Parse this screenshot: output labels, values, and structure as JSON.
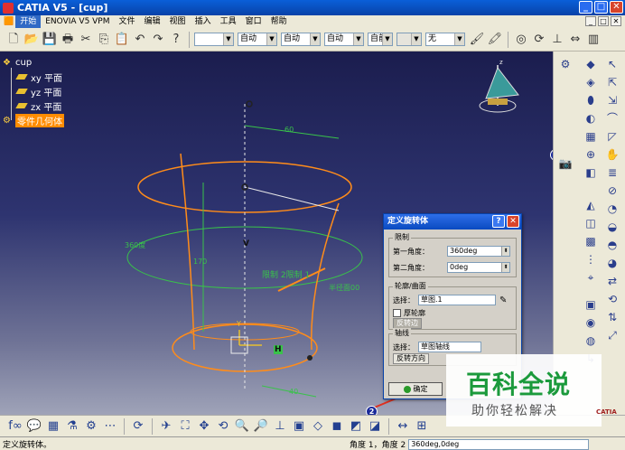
{
  "window": {
    "title": "CATIA V5 - [cup]",
    "buttons": [
      "_",
      "□",
      "✕"
    ]
  },
  "menu": {
    "items": [
      "开始",
      "ENOVIA V5 VPM",
      "文件",
      "编辑",
      "视图",
      "插入",
      "工具",
      "窗口",
      "帮助"
    ],
    "active_index": 0,
    "doc_buttons": [
      "_",
      "□",
      "✕"
    ]
  },
  "toolbar": {
    "selects": [
      {
        "value": ""
      },
      {
        "value": "自动"
      },
      {
        "value": "自动"
      },
      {
        "value": "自动"
      },
      {
        "value": "自前"
      },
      {
        "value": ""
      },
      {
        "value": "无"
      }
    ]
  },
  "tree": {
    "root": "cup",
    "items": [
      "xy 平面",
      "yz 平面",
      "zx 平面"
    ],
    "selected": "零件几何体"
  },
  "viewport": {
    "labels": {
      "dim_60": "60",
      "dim_360": "360度",
      "dim_h": "170",
      "limit_label": "限制 2限制 1",
      "profile_label": "半径面00",
      "v_label": "V",
      "h_label": "H",
      "y_label": "Y",
      "dim_bottom": "40"
    },
    "colors": {
      "profile": "#ff8c1a",
      "dimension": "#39c24a",
      "axis": "#e8e8e8"
    }
  },
  "dialog": {
    "title": "定义旋转体",
    "limits_group": "限制",
    "first_angle_label": "第一角度：",
    "first_angle_value": "360deg",
    "second_angle_label": "第二角度：",
    "second_angle_value": "0deg",
    "profile_group": "轮廓/曲面",
    "select_label": "选择：",
    "profile_value": "草图.1",
    "thick_profile_label": "厚轮廓",
    "reverse_side_button": "反转边",
    "axis_group": "轴线",
    "axis_select_label": "选择：",
    "axis_value": "草图轴线",
    "reverse_direction_button": "反转方向",
    "ok_button": "确定",
    "title_buttons": [
      "?",
      "✕"
    ]
  },
  "callouts": [
    "1",
    "2"
  ],
  "status": {
    "left_text": "定义旋转体。",
    "field_label": "角度 1，角度 2",
    "field_value": "360deg,0deg"
  },
  "watermark": {
    "title": "百科全说",
    "subtitle": "助你轻松解决"
  },
  "logo_text": "CATIA"
}
